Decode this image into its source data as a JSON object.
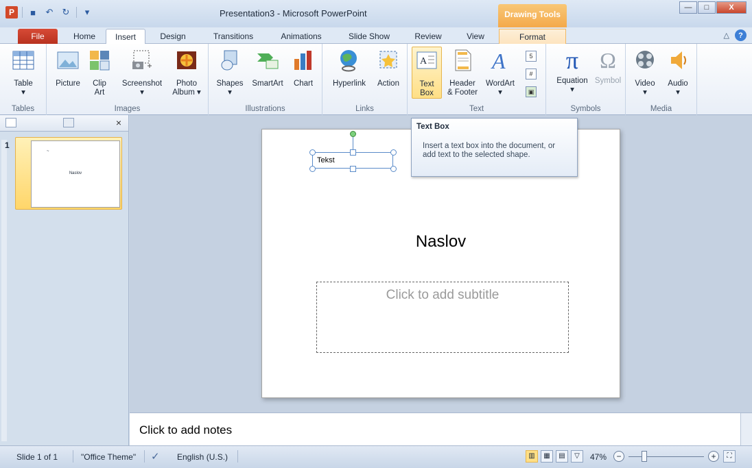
{
  "window": {
    "title": "Presentation3 - Microsoft PowerPoint",
    "context_tools": "Drawing Tools",
    "minimize": "—",
    "maximize": "□",
    "close": "X"
  },
  "qat": {
    "logo": "P",
    "save": "■",
    "undo": "↶",
    "redo": "↻",
    "customize": "▾"
  },
  "tabs": [
    "File",
    "Home",
    "Insert",
    "Design",
    "Transitions",
    "Animations",
    "Slide Show",
    "Review",
    "View",
    "Format"
  ],
  "ribbon": {
    "groups": {
      "tables": "Tables",
      "images": "Images",
      "illustrations": "Illustrations",
      "links": "Links",
      "text": "Text",
      "symbols": "Symbols",
      "media": "Media"
    },
    "buttons": {
      "table": "Table",
      "picture": "Picture",
      "clip_art_1": "Clip",
      "clip_art_2": "Art",
      "screenshot": "Screenshot",
      "photo_album_1": "Photo",
      "photo_album_2": "Album ▾",
      "shapes": "Shapes",
      "smartart": "SmartArt",
      "chart": "Chart",
      "hyperlink": "Hyperlink",
      "action": "Action",
      "text_box_1": "Text",
      "text_box_2": "Box",
      "header_footer_1": "Header",
      "header_footer_2": "& Footer",
      "wordart": "WordArt",
      "equation": "Equation",
      "symbol": "Symbol",
      "video": "Video",
      "audio": "Audio",
      "dropdown": "▾"
    }
  },
  "slides_pane": {
    "slide_number": "1",
    "thumb_title": "Naslov",
    "thumb_tb": "~",
    "close": "×"
  },
  "slide": {
    "textbox_text": "Tekst",
    "title": "Naslov",
    "subtitle_placeholder": "Click to add subtitle"
  },
  "tooltip": {
    "title": "Text Box",
    "body": "Insert a text box into the document, or add text to the selected shape."
  },
  "notes": {
    "placeholder": "Click to add notes"
  },
  "statusbar": {
    "slide": "Slide 1 of 1",
    "theme": "\"Office Theme\"",
    "language": "English (U.S.)",
    "zoom": "47%",
    "zoom_out": "−",
    "zoom_in": "+"
  },
  "zoom_level_fraction": 0.47
}
